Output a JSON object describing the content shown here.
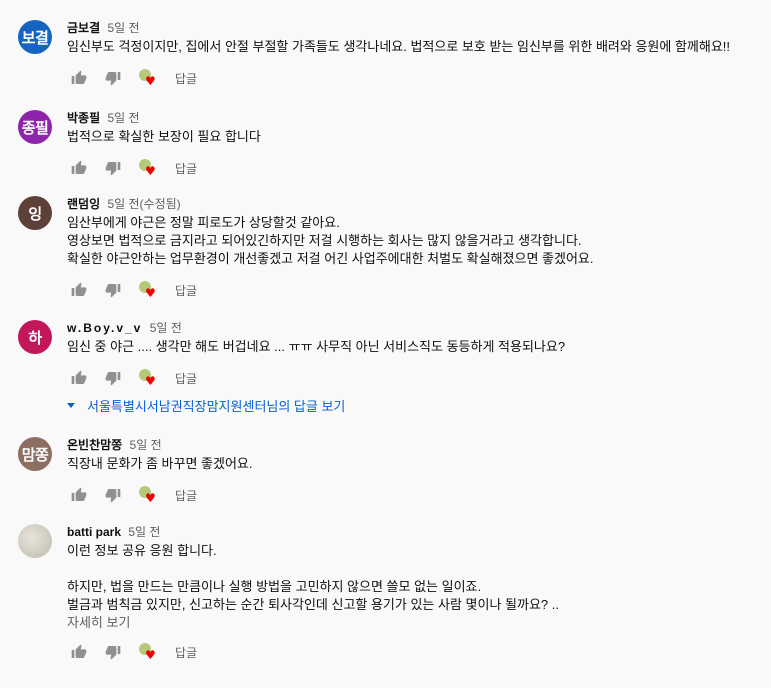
{
  "comments": [
    {
      "avatar_text": "보결",
      "avatar_color": "#1565c0",
      "author": "금보결",
      "time": "5일 전",
      "text": "임신부도 걱정이지만, 집에서 안절 부절할 가족들도 생각나네요. 법적으로 보호 받는 임신부를 위한 배려와 응원에 함께해요!!",
      "reply": "답글"
    },
    {
      "avatar_text": "종필",
      "avatar_color": "#8e24aa",
      "author": "박종필",
      "time": "5일 전",
      "text": "법적으로 확실한 보장이 필요 합니다",
      "reply": "답글"
    },
    {
      "avatar_text": "잉",
      "avatar_color": "#5d4037",
      "author": "랜덤잉",
      "time": "5일 전(수정됨)",
      "text": "임산부에게 야근은 정말 피로도가 상당할것 같아요.\n영상보면 법적으로 금지라고 되어있긴하지만 저걸 시행하는 회사는 많지 않을거라고 생각합니다.\n확실한 야근안하는 업무환경이 개선좋겠고 저걸 어긴 사업주에대한 처벌도 확실해졌으면 좋겠어요.",
      "reply": "답글"
    },
    {
      "avatar_text": "하",
      "avatar_color": "#c2185b",
      "author": "w.Boy.v_v",
      "time": "5일 전",
      "text": "임신 중 야근 .... 생각만 해도 버겁네요 ... ㅠㅠ 사무직 아닌 서비스직도 동등하게 적용되나요?",
      "reply": "답글",
      "replies_link": "서울특별시서남권직장맘지원센터님의 답글 보기"
    },
    {
      "avatar_text": "맘쫑",
      "avatar_color": "#8d6e63",
      "author": "온빈찬맘쫑",
      "time": "5일 전",
      "text": "직장내 문화가 좀 바꾸면 좋겠어요.",
      "reply": "답글"
    },
    {
      "avatar_text": "",
      "avatar_color": "#d6d1c7",
      "author": "batti park",
      "time": "5일 전",
      "text": "이런 정보 공유 응원 합니다.\n\n하지만, 법을 만드는 만큼이나 실행 방법을 고민하지 않으면 쓸모 없는 일이죠.\n벌금과 범칙금 있지만, 신고하는 순간 퇴사각인데 신고할 용기가 있는 사람 몇이나 될까요? ..",
      "more": "자세히 보기",
      "reply": "답글"
    }
  ],
  "icons": {
    "like": "thumbs-up-icon",
    "dislike": "thumbs-down-icon",
    "creator_heart": "creator-heart-icon",
    "expand": "caret-down-icon"
  }
}
